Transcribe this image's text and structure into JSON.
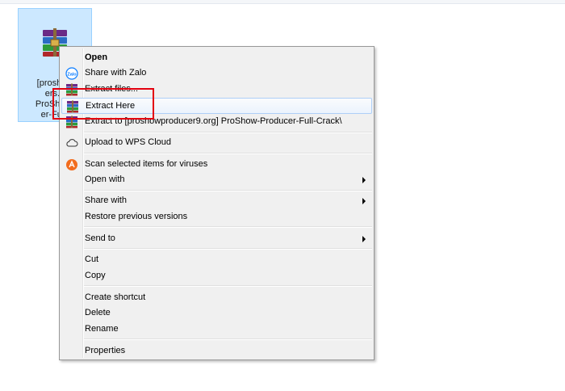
{
  "file": {
    "label_lines": [
      "[proshow",
      "ers.o",
      "ProShow-",
      "er-Full-"
    ],
    "icon": "winrar-archive-icon"
  },
  "context_menu": {
    "items": [
      {
        "label": "Open",
        "bold": true
      },
      {
        "label": "Share with Zalo",
        "icon": "zalo-icon"
      },
      {
        "label": "Extract files...",
        "icon": "winrar-icon"
      },
      {
        "label": "Extract Here",
        "icon": "winrar-icon",
        "highlighted": true
      },
      {
        "label": "Extract to [proshowproducer9.org] ProShow-Producer-Full-Crack\\",
        "icon": "winrar-icon"
      },
      {
        "label": "Upload to WPS Cloud",
        "icon": "cloud-icon"
      },
      {
        "label": "Scan selected items for viruses",
        "icon": "avast-icon"
      },
      {
        "label": "Open with",
        "submenu": true
      },
      {
        "label": "Share with",
        "submenu": true
      },
      {
        "label": "Restore previous versions"
      },
      {
        "label": "Send to",
        "submenu": true
      },
      {
        "label": "Cut"
      },
      {
        "label": "Copy"
      },
      {
        "label": "Create shortcut"
      },
      {
        "label": "Delete"
      },
      {
        "label": "Rename"
      },
      {
        "label": "Properties"
      }
    ]
  },
  "colors": {
    "selection_bg": "#cce8ff",
    "menu_bg": "#f0f0f0",
    "annotation_red": "#e3000f"
  }
}
